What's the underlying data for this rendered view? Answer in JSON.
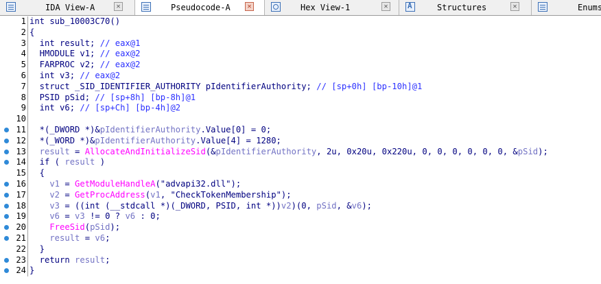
{
  "tabs": [
    {
      "label": "IDA View-A",
      "icon": "ida-view-icon",
      "active": false
    },
    {
      "label": "Pseudocode-A",
      "icon": "pseudocode-icon",
      "active": true
    },
    {
      "label": "Hex View-1",
      "icon": "hex-view-icon",
      "active": false
    },
    {
      "label": "Structures",
      "icon": "structures-icon",
      "active": false
    },
    {
      "label": "Enums",
      "icon": "enums-icon",
      "active": false
    }
  ],
  "close_glyph": "✕",
  "colors": {
    "keyword": "#000080",
    "comment": "#2b30ff",
    "variable": "#7272c4",
    "function": "#ff00ff",
    "breakpoint_dot": "#2f8ad8"
  },
  "code_lines": [
    {
      "n": "1",
      "dot": false,
      "segs": [
        [
          "kw",
          "int sub_10003C70()"
        ]
      ]
    },
    {
      "n": "2",
      "dot": false,
      "segs": [
        [
          "kw",
          "{"
        ]
      ]
    },
    {
      "n": "3",
      "dot": false,
      "segs": [
        [
          "kw",
          "  int result; "
        ],
        [
          "cm",
          "// eax@1"
        ]
      ]
    },
    {
      "n": "4",
      "dot": false,
      "segs": [
        [
          "kw",
          "  HMODULE v1; "
        ],
        [
          "cm",
          "// eax@2"
        ]
      ]
    },
    {
      "n": "5",
      "dot": false,
      "segs": [
        [
          "kw",
          "  FARPROC v2; "
        ],
        [
          "cm",
          "// eax@2"
        ]
      ]
    },
    {
      "n": "6",
      "dot": false,
      "segs": [
        [
          "kw",
          "  int v3; "
        ],
        [
          "cm",
          "// eax@2"
        ]
      ]
    },
    {
      "n": "7",
      "dot": false,
      "segs": [
        [
          "kw",
          "  struct _SID_IDENTIFIER_AUTHORITY pIdentifierAuthority; "
        ],
        [
          "cm",
          "// [sp+0h] [bp-10h]@1"
        ]
      ]
    },
    {
      "n": "8",
      "dot": false,
      "segs": [
        [
          "kw",
          "  PSID pSid; "
        ],
        [
          "cm",
          "// [sp+8h] [bp-8h]@1"
        ]
      ]
    },
    {
      "n": "9",
      "dot": false,
      "segs": [
        [
          "kw",
          "  int v6; "
        ],
        [
          "cm",
          "// [sp+Ch] [bp-4h]@2"
        ]
      ]
    },
    {
      "n": "10",
      "dot": false,
      "segs": [
        [
          "kw",
          ""
        ]
      ]
    },
    {
      "n": "11",
      "dot": true,
      "segs": [
        [
          "kw",
          "  *(_DWORD *)&"
        ],
        [
          "vr",
          "pIdentifierAuthority"
        ],
        [
          "kw",
          ".Value[0] = 0;"
        ]
      ]
    },
    {
      "n": "12",
      "dot": true,
      "segs": [
        [
          "kw",
          "  *(_WORD *)&"
        ],
        [
          "vr",
          "pIdentifierAuthority"
        ],
        [
          "kw",
          ".Value[4] = 1280;"
        ]
      ]
    },
    {
      "n": "13",
      "dot": true,
      "segs": [
        [
          "vr",
          "  result"
        ],
        [
          "kw",
          " = "
        ],
        [
          "fn",
          "AllocateAndInitializeSid"
        ],
        [
          "kw",
          "(&"
        ],
        [
          "vr",
          "pIdentifierAuthority"
        ],
        [
          "kw",
          ", 2u, 0x20u, 0x220u, 0, 0, 0, 0, 0, 0, &"
        ],
        [
          "vr",
          "pSid"
        ],
        [
          "kw",
          ");"
        ]
      ]
    },
    {
      "n": "14",
      "dot": true,
      "segs": [
        [
          "kw",
          "  if ( "
        ],
        [
          "vr",
          "result"
        ],
        [
          "kw",
          " )"
        ]
      ]
    },
    {
      "n": "15",
      "dot": false,
      "segs": [
        [
          "kw",
          "  {"
        ]
      ]
    },
    {
      "n": "16",
      "dot": true,
      "segs": [
        [
          "vr",
          "    v1"
        ],
        [
          "kw",
          " = "
        ],
        [
          "fn",
          "GetModuleHandleA"
        ],
        [
          "kw",
          "(\"advapi32.dll\");"
        ]
      ]
    },
    {
      "n": "17",
      "dot": true,
      "segs": [
        [
          "vr",
          "    v2"
        ],
        [
          "kw",
          " = "
        ],
        [
          "fn",
          "GetProcAddress"
        ],
        [
          "kw",
          "("
        ],
        [
          "vr",
          "v1"
        ],
        [
          "kw",
          ", \"CheckTokenMembership\");"
        ]
      ]
    },
    {
      "n": "18",
      "dot": true,
      "segs": [
        [
          "vr",
          "    v3"
        ],
        [
          "kw",
          " = ((int (__stdcall *)(_DWORD, PSID, int *))"
        ],
        [
          "vr",
          "v2"
        ],
        [
          "kw",
          ")(0, "
        ],
        [
          "vr",
          "pSid"
        ],
        [
          "kw",
          ", &"
        ],
        [
          "vr",
          "v6"
        ],
        [
          "kw",
          ");"
        ]
      ]
    },
    {
      "n": "19",
      "dot": true,
      "segs": [
        [
          "vr",
          "    v6"
        ],
        [
          "kw",
          " = "
        ],
        [
          "vr",
          "v3"
        ],
        [
          "kw",
          " != 0 ? "
        ],
        [
          "vr",
          "v6"
        ],
        [
          "kw",
          " : 0;"
        ]
      ]
    },
    {
      "n": "20",
      "dot": true,
      "segs": [
        [
          "fn",
          "    FreeSid"
        ],
        [
          "kw",
          "("
        ],
        [
          "vr",
          "pSid"
        ],
        [
          "kw",
          ");"
        ]
      ]
    },
    {
      "n": "21",
      "dot": true,
      "segs": [
        [
          "vr",
          "    result"
        ],
        [
          "kw",
          " = "
        ],
        [
          "vr",
          "v6"
        ],
        [
          "kw",
          ";"
        ]
      ]
    },
    {
      "n": "22",
      "dot": false,
      "segs": [
        [
          "kw",
          "  }"
        ]
      ]
    },
    {
      "n": "23",
      "dot": true,
      "segs": [
        [
          "kw",
          "  return "
        ],
        [
          "vr",
          "result"
        ],
        [
          "kw",
          ";"
        ]
      ]
    },
    {
      "n": "24",
      "dot": true,
      "segs": [
        [
          "kw",
          "}"
        ]
      ]
    }
  ]
}
